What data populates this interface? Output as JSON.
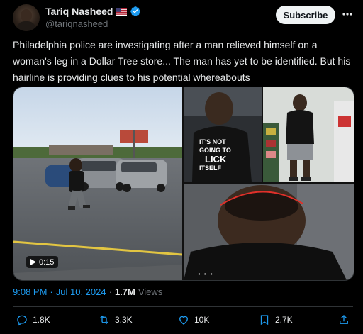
{
  "author": {
    "name": "Tariq Nasheed",
    "handle": "@tariqnasheed"
  },
  "header": {
    "subscribe_label": "Subscribe"
  },
  "tweet": {
    "text": "Philadelphia police are investigating  after a man relieved himself on a woman's leg in a Dollar Tree store...  The man has yet to be identified. But his hairline is providing clues to his potential whereabouts"
  },
  "media": {
    "video_duration": "0:15",
    "shirt_text_lines": [
      "IT'S NOT",
      "GOING TO",
      "LICK",
      "ITSELF"
    ]
  },
  "meta": {
    "time": "9:08 PM",
    "date": "Jul 10, 2024",
    "separator": "·",
    "views_count": "1.7M",
    "views_label": "Views"
  },
  "actions": {
    "replies": "1.8K",
    "reposts": "3.3K",
    "likes": "10K",
    "bookmarks": "2.7K"
  },
  "colors": {
    "background": "#000000",
    "text": "#e7e9ea",
    "muted": "#71767b",
    "accent": "#1d9bf0",
    "subscribe_bg": "#eff3f4"
  },
  "icons": [
    "verified-badge-icon",
    "us-flag-icon",
    "more-icon",
    "play-icon",
    "reply-icon",
    "repost-icon",
    "like-icon",
    "bookmark-icon",
    "share-icon"
  ]
}
